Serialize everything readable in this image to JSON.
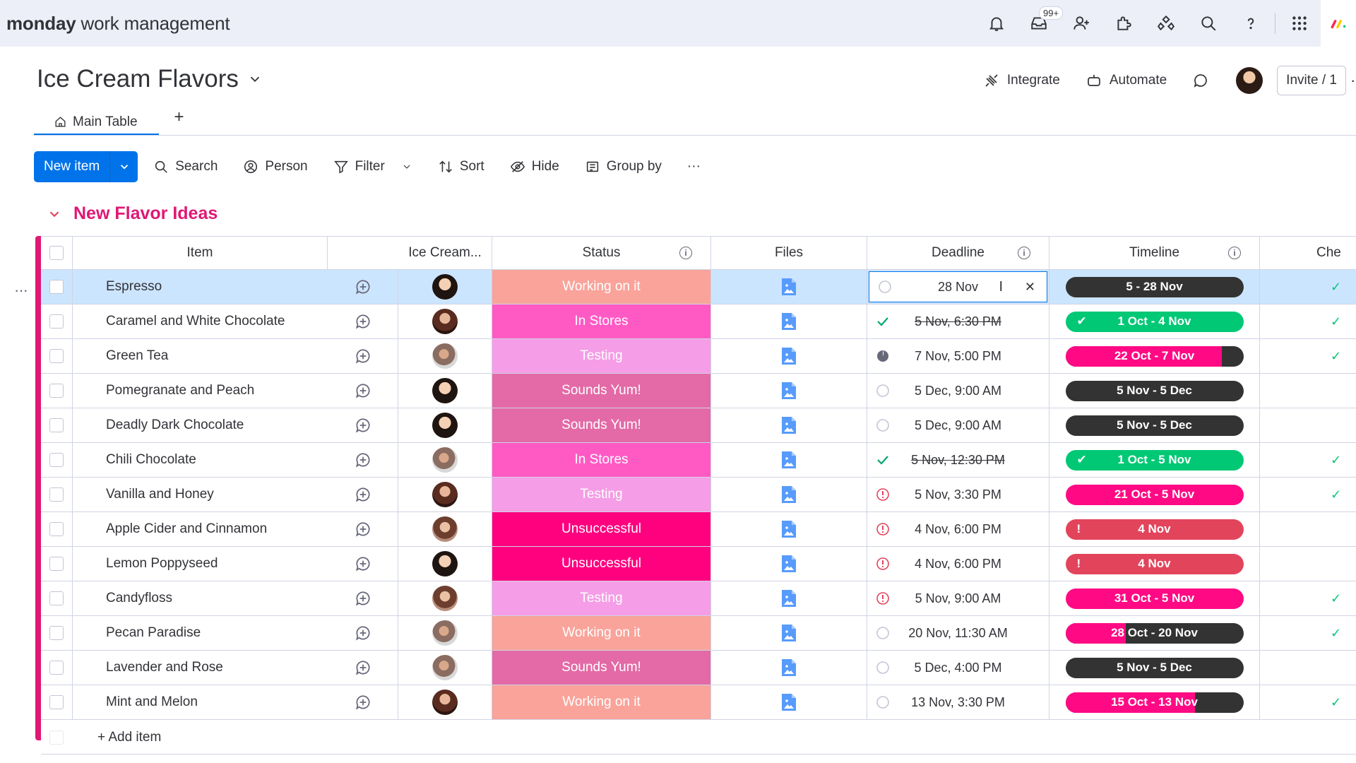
{
  "brand": {
    "bold": "monday",
    "rest": " work management"
  },
  "topbar": {
    "inbox_badge": "99+"
  },
  "board": {
    "title": "Ice Cream Flavors"
  },
  "header_actions": {
    "integrate": "Integrate",
    "automate": "Automate",
    "invite": "Invite / 1"
  },
  "tabs": {
    "main": "Main Table",
    "add": "+"
  },
  "toolbar": {
    "new_item": "New item",
    "search": "Search",
    "person": "Person",
    "filter": "Filter",
    "sort": "Sort",
    "hide": "Hide",
    "group_by": "Group by",
    "more": "···"
  },
  "group": {
    "title": "New Flavor Ideas",
    "color": "#e01874"
  },
  "columns": {
    "item": "Item",
    "person": "Ice Cream...",
    "status": "Status",
    "files": "Files",
    "deadline": "Deadline",
    "timeline": "Timeline",
    "check": "Che"
  },
  "status_colors": {
    "Working on it": "#f9a39a",
    "In Stores": "#ff5ac4",
    "Testing": "#f59de6",
    "Sounds Yum!": "#e36aa6",
    "Unsuccessful": "#ff007f"
  },
  "rows": [
    {
      "item": "Espresso",
      "avatar": "a1",
      "status": "Working on it",
      "deadline": "28 Nov",
      "deadline_icon": "circle",
      "editing": true,
      "timeline": "5 - 28 Nov",
      "tl_style": "dark",
      "check": "✓"
    },
    {
      "item": "Caramel and White Chocolate",
      "avatar": "a2",
      "status": "In Stores",
      "deadline": "5 Nov, 6:30 PM",
      "deadline_icon": "check",
      "strike": true,
      "timeline": "1 Oct - 4 Nov",
      "tl_style": "done",
      "check": "✓"
    },
    {
      "item": "Green Tea",
      "avatar": "a3",
      "status": "Testing",
      "deadline": "7 Nov, 5:00 PM",
      "deadline_icon": "half",
      "timeline": "22 Oct - 7 Nov",
      "tl_style": "partial",
      "tl_progress": 0.88,
      "check": "✓"
    },
    {
      "item": "Pomegranate and Peach",
      "avatar": "a1",
      "status": "Sounds Yum!",
      "deadline": "5 Dec, 9:00 AM",
      "deadline_icon": "circle",
      "timeline": "5 Nov - 5 Dec",
      "tl_style": "dark",
      "check": ""
    },
    {
      "item": "Deadly Dark Chocolate",
      "avatar": "a1",
      "status": "Sounds Yum!",
      "deadline": "5 Dec, 9:00 AM",
      "deadline_icon": "circle",
      "timeline": "5 Nov - 5 Dec",
      "tl_style": "dark",
      "check": ""
    },
    {
      "item": "Chili Chocolate",
      "avatar": "a3",
      "status": "In Stores",
      "deadline": "5 Nov, 12:30 PM",
      "deadline_icon": "check",
      "strike": true,
      "timeline": "1 Oct - 5 Nov",
      "tl_style": "done",
      "check": "✓"
    },
    {
      "item": "Vanilla and Honey",
      "avatar": "a2",
      "status": "Testing",
      "deadline": "5 Nov, 3:30 PM",
      "deadline_icon": "alert",
      "timeline": "21 Oct - 5 Nov",
      "tl_style": "pink",
      "check": "✓"
    },
    {
      "item": "Apple Cider and Cinnamon",
      "avatar": "a4",
      "status": "Unsuccessful",
      "deadline": "4 Nov, 6:00 PM",
      "deadline_icon": "alert",
      "timeline": "4 Nov",
      "tl_style": "overdue",
      "check": ""
    },
    {
      "item": "Lemon Poppyseed",
      "avatar": "a1",
      "status": "Unsuccessful",
      "deadline": "4 Nov, 6:00 PM",
      "deadline_icon": "alert",
      "timeline": "4 Nov",
      "tl_style": "overdue",
      "check": ""
    },
    {
      "item": "Candyfloss",
      "avatar": "a4",
      "status": "Testing",
      "deadline": "5 Nov, 9:00 AM",
      "deadline_icon": "alert",
      "timeline": "31 Oct - 5 Nov",
      "tl_style": "pink",
      "check": "✓"
    },
    {
      "item": "Pecan Paradise",
      "avatar": "a3",
      "status": "Working on it",
      "deadline": "20 Nov, 11:30 AM",
      "deadline_icon": "circle",
      "timeline": "28 Oct - 20 Nov",
      "tl_style": "partial",
      "tl_progress": 0.34,
      "check": "✓"
    },
    {
      "item": "Lavender and Rose",
      "avatar": "a3",
      "status": "Sounds Yum!",
      "deadline": "5 Dec, 4:00 PM",
      "deadline_icon": "circle",
      "timeline": "5 Nov - 5 Dec",
      "tl_style": "dark",
      "check": ""
    },
    {
      "item": "Mint and Melon",
      "avatar": "a2",
      "status": "Working on it",
      "deadline": "13 Nov, 3:30 PM",
      "deadline_icon": "circle",
      "timeline": "15 Oct - 13 Nov",
      "tl_style": "partial",
      "tl_progress": 0.73,
      "check": "✓"
    }
  ],
  "add_item": "+ Add item"
}
